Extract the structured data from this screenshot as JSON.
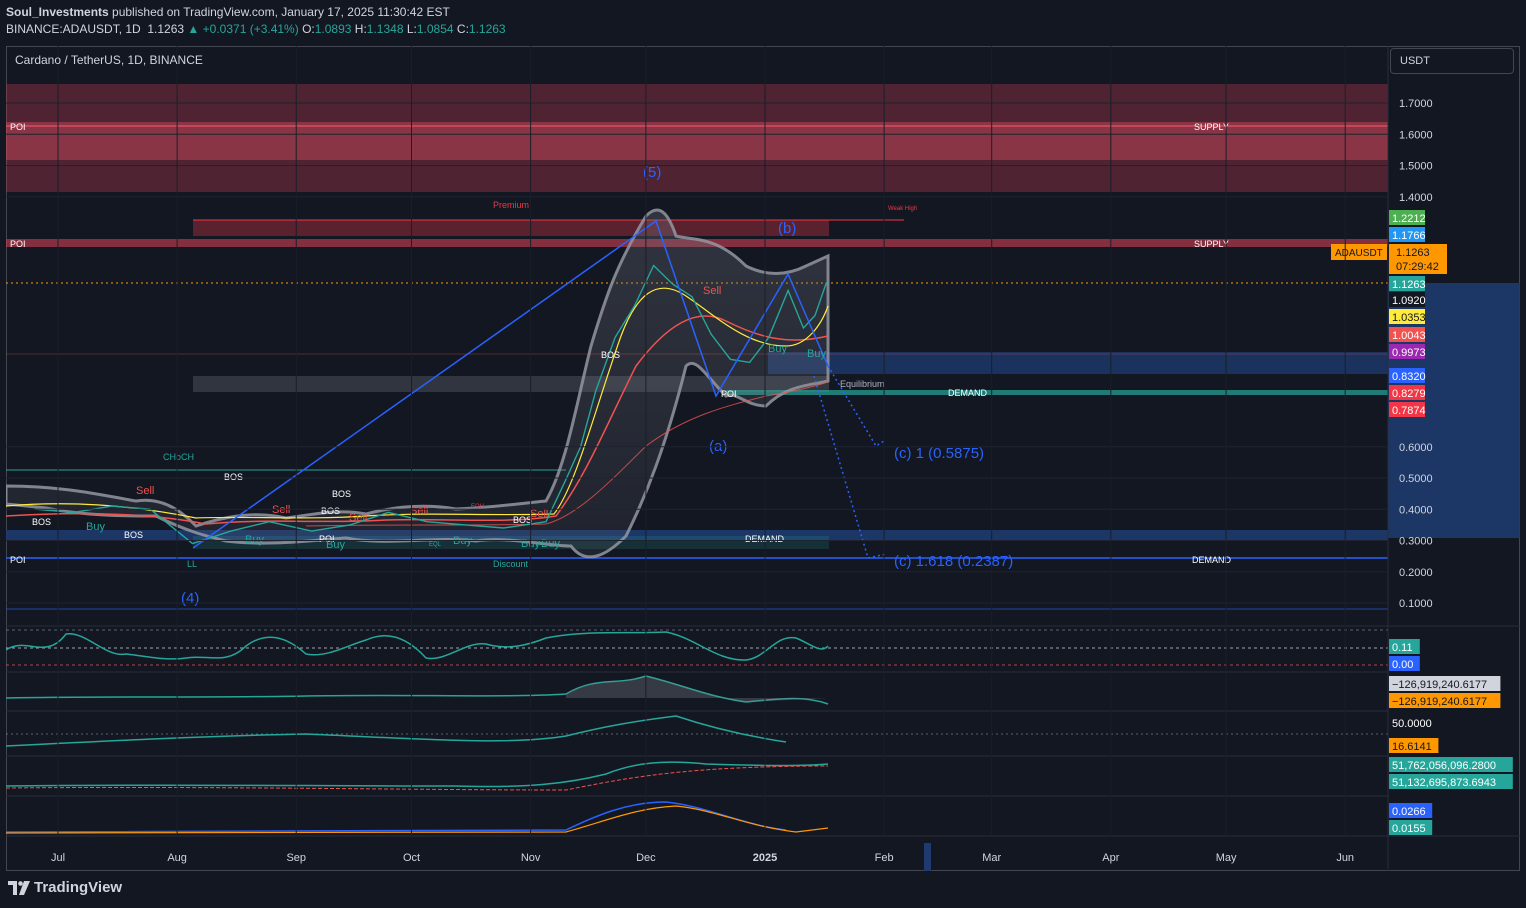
{
  "header": {
    "publisher": "Soul_Investments",
    "published_text": " published on TradingView.com, January 17, 2025 11:30:42 EST",
    "symbol": "BINANCE:ADAUSDT, 1D",
    "price": "1.1263",
    "change": "+0.0371 (+3.41%)",
    "o_label": "O:",
    "o": "1.0893",
    "h_label": "H:",
    "h": "1.1348",
    "l_label": "L:",
    "l": "1.0854",
    "c_label": "C:",
    "c": "1.1263"
  },
  "symbol_title": "Cardano / TetherUS, 1D, BINANCE",
  "currency": "USDT",
  "footer": {
    "brand": "TradingView"
  },
  "colors": {
    "bg": "#131722",
    "grid": "#1f2330",
    "up": "#26a69a",
    "down": "#ef5350",
    "supply": "#b2374a",
    "demand_band": "#1e3a6e",
    "wave": "#2962ff",
    "text": "#d1d4dc"
  },
  "chart_data": {
    "type": "line",
    "title": "Cardano / TetherUS, 1D, BINANCE",
    "xlabel": "",
    "ylabel": "",
    "x_ticks": [
      "Jul",
      "Aug",
      "Sep",
      "Oct",
      "Nov",
      "Dec",
      "2025",
      "Feb",
      "Mar",
      "Apr",
      "May",
      "Jun"
    ],
    "y_ticks": [
      "1.7000",
      "1.6000",
      "1.5000",
      "1.4000",
      "0.6000",
      "0.5000",
      "0.4000",
      "0.3000",
      "0.2000",
      "0.1000"
    ],
    "ylim": [
      0.0,
      1.8
    ],
    "grid": true,
    "series": [
      {
        "name": "ADAUSDT",
        "x": [
          "2024-06-25",
          "2024-07-05",
          "2024-07-15",
          "2024-07-25",
          "2024-08-05",
          "2024-08-15",
          "2024-08-25",
          "2024-09-05",
          "2024-09-15",
          "2024-09-25",
          "2024-10-05",
          "2024-10-15",
          "2024-10-25",
          "2024-11-05",
          "2024-11-10",
          "2024-11-14",
          "2024-11-18",
          "2024-11-23",
          "2024-11-28",
          "2024-12-03",
          "2024-12-08",
          "2024-12-13",
          "2024-12-18",
          "2024-12-23",
          "2024-12-28",
          "2025-01-02",
          "2025-01-07",
          "2025-01-11",
          "2025-01-14",
          "2025-01-17"
        ],
        "values": [
          0.4,
          0.39,
          0.41,
          0.4,
          0.29,
          0.33,
          0.36,
          0.33,
          0.35,
          0.39,
          0.36,
          0.35,
          0.34,
          0.36,
          0.49,
          0.6,
          0.78,
          0.95,
          1.05,
          1.18,
          1.12,
          1.08,
          0.96,
          0.88,
          0.87,
          0.95,
          1.1,
          0.98,
          1.02,
          1.1263
        ]
      }
    ],
    "price_labels": [
      {
        "text": "1.2212",
        "value": 1.2212,
        "color": "#4caf50"
      },
      {
        "text": "1.1766",
        "value": 1.1766,
        "color": "#2196f3"
      },
      {
        "text": "1.1263",
        "value": 1.1263,
        "color": "#26a69a"
      },
      {
        "text": "1.0920",
        "value": 1.092,
        "color": "#131722"
      },
      {
        "text": "1.0353",
        "value": 1.0353,
        "color": "#ffeb3b"
      },
      {
        "text": "1.0043",
        "value": 1.0043,
        "color": "#ef5350"
      },
      {
        "text": "0.9973",
        "value": 0.9973,
        "color": "#9c27b0"
      },
      {
        "text": "0.8320",
        "value": 0.832,
        "color": "#2962ff"
      },
      {
        "text": "0.8279",
        "value": 0.8279,
        "color": "#f23645"
      },
      {
        "text": "0.7874",
        "value": 0.7874,
        "color": "#f23645"
      }
    ],
    "current_price_tag": {
      "symbol": "ADAUSDT",
      "price": "1.1263",
      "countdown": "07:29:42"
    },
    "annotations": [
      "(5)",
      "(4)",
      "(a)",
      "(b)",
      "(c) 1 (0.5875)",
      "(c) 1.618 (0.2387)",
      "POI",
      "SUPPLY",
      "DEMAND",
      "Premium",
      "Discount",
      "Equilibrium",
      "Weak High",
      "CHoCH",
      "BOS",
      "LL",
      "EQH",
      "EQL",
      "Buy",
      "Sell"
    ],
    "indicator_labels": [
      {
        "text": "0.11",
        "color": "#26a69a"
      },
      {
        "text": "0.00",
        "color": "#2962ff"
      },
      {
        "text": "−126,919,240.6177",
        "color": "#d1d4dc"
      },
      {
        "text": "−126,919,240.6177",
        "color": "#ff9800"
      },
      {
        "text": "50.0000",
        "color": "#131722"
      },
      {
        "text": "16.6141",
        "color": "#ff9800"
      },
      {
        "text": "51,762,056,096.2800",
        "color": "#26a69a"
      },
      {
        "text": "51,132,695,873.6943",
        "color": "#26a69a"
      },
      {
        "text": "0.0266",
        "color": "#2962ff"
      },
      {
        "text": "0.0155",
        "color": "#26a69a"
      }
    ]
  }
}
